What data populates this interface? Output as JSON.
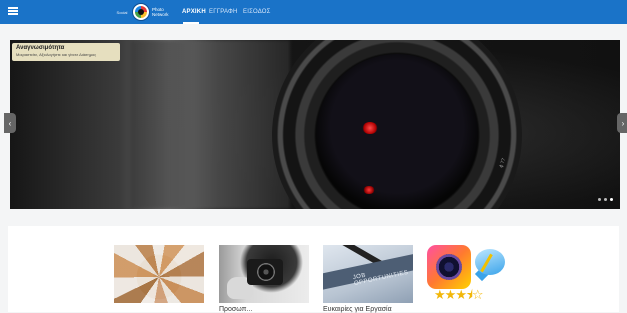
{
  "navbar": {
    "menu_icon": "hamburger-icon",
    "brand_small": "Social",
    "brand_name_line1": "Photo",
    "brand_name_line2": "Network",
    "links": [
      {
        "label": "ΑΡΧΙΚΗ",
        "active": true
      },
      {
        "label": "ΕΓΓΡΑΦΗ",
        "active": false
      },
      {
        "label": "ΕΙΣΟΔΟΣ",
        "active": false
      }
    ],
    "color": "#1a73c8"
  },
  "slider": {
    "caption_title": "Αναγνωσιμότητα",
    "caption_subtitle": "Μοιραστείτε, Αξιολογήστε και γίνετε Διάσημος",
    "lens_text": "ϕ 77",
    "prev_icon": "chevron-left-icon",
    "next_icon": "chevron-right-icon",
    "dots": [
      false,
      false,
      true
    ],
    "caption_color": "#e6dfbf"
  },
  "tiles": [
    {
      "image": "hands-together-image",
      "label": ""
    },
    {
      "image": "photographer-camera-image",
      "label": "Προσωπ..."
    },
    {
      "image": "job-opportunities-image",
      "label": "Ευκαιρίες για Εργασία"
    },
    {
      "image": "photo-app-rating-image",
      "label": ""
    }
  ],
  "rating": {
    "stars": 3.5,
    "max": 5,
    "color": "#f2b70a"
  }
}
